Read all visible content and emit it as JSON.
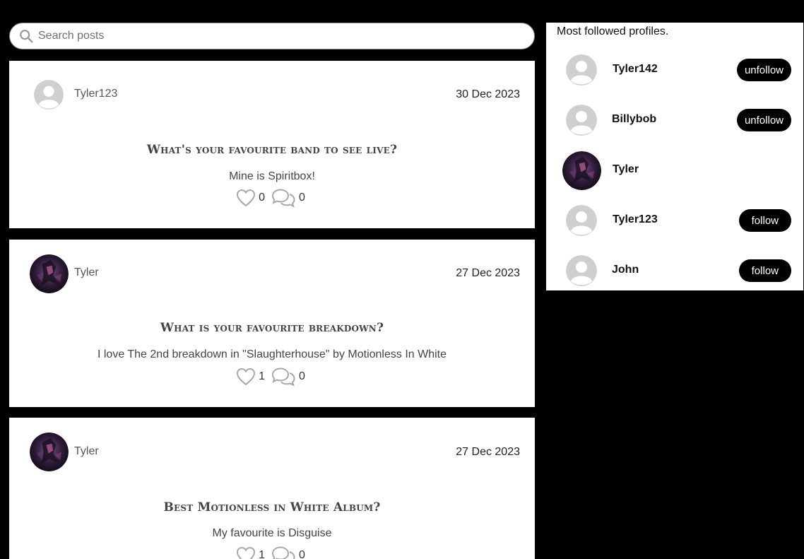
{
  "search": {
    "placeholder": "Search posts"
  },
  "posts": [
    {
      "username": "Tyler123",
      "avatar": "default-avatar-icon",
      "date": "30 Dec 2023",
      "title": "What's your favourite band to see live?",
      "body": "Mine is Spiritbox!",
      "likes": "0",
      "comments": "0"
    },
    {
      "username": "Tyler",
      "avatar": "custom-avatar-image",
      "date": "27 Dec 2023",
      "title": "What is your favourite breakdown?",
      "body": "I love The 2nd breakdown in \"Slaughterhouse\" by Motionless In White",
      "likes": "1",
      "comments": "0"
    },
    {
      "username": "Tyler",
      "avatar": "custom-avatar-image",
      "date": "27 Dec 2023",
      "title": "Best Motionless in White Album?",
      "body": "My favourite is Disguise",
      "likes": "1",
      "comments": "0"
    }
  ],
  "sidebar": {
    "heading": "Most followed profiles.",
    "profiles": [
      {
        "name": "Tyler142",
        "avatar": "default-avatar-icon",
        "action": "unfollow"
      },
      {
        "name": "Billybob",
        "avatar": "default-avatar-icon",
        "action": "unfollow"
      },
      {
        "name": "Tyler",
        "avatar": "custom-avatar-image",
        "action": ""
      },
      {
        "name": "Tyler123",
        "avatar": "default-avatar-icon",
        "action": "follow"
      },
      {
        "name": "John",
        "avatar": "default-avatar-icon",
        "action": "follow"
      }
    ]
  },
  "colors": {
    "page_bg": "#000000",
    "card_bg": "#ffffff",
    "button_bg": "#000000",
    "icon_gray": "#b5b5b5"
  }
}
